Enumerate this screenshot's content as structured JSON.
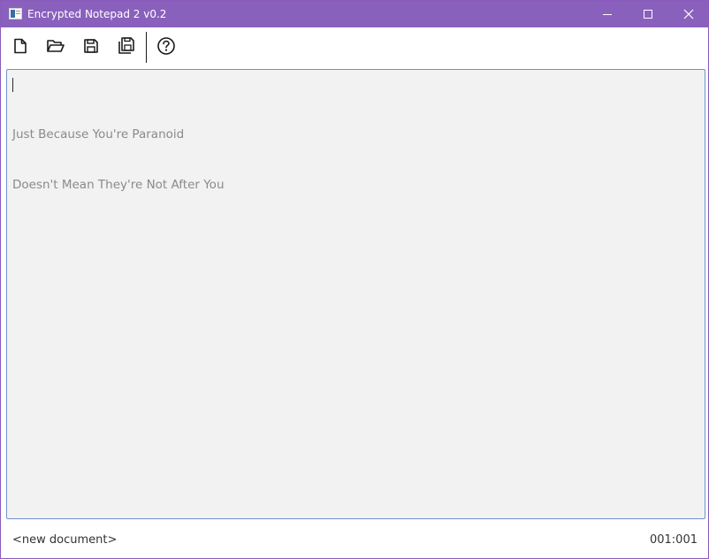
{
  "window": {
    "title": "Encrypted Notepad 2 v0.2",
    "title_bar_color": "#8a60bd"
  },
  "window_controls": {
    "minimize_icon": "minimize-icon",
    "maximize_icon": "maximize-icon",
    "close_icon": "close-icon"
  },
  "toolbar": {
    "buttons": [
      {
        "icon": "new-file-icon"
      },
      {
        "icon": "open-folder-icon"
      },
      {
        "icon": "save-icon"
      },
      {
        "icon": "save-as-icon"
      },
      {
        "icon": "help-icon"
      }
    ]
  },
  "editor": {
    "lines": [
      "Just Because You're Paranoid",
      "Doesn't Mean They're Not After You"
    ],
    "text_color": "#8a8a8a",
    "border_color": "#6f93cf"
  },
  "statusbar": {
    "document_name": "<new document>",
    "cursor_position": "001:001"
  }
}
